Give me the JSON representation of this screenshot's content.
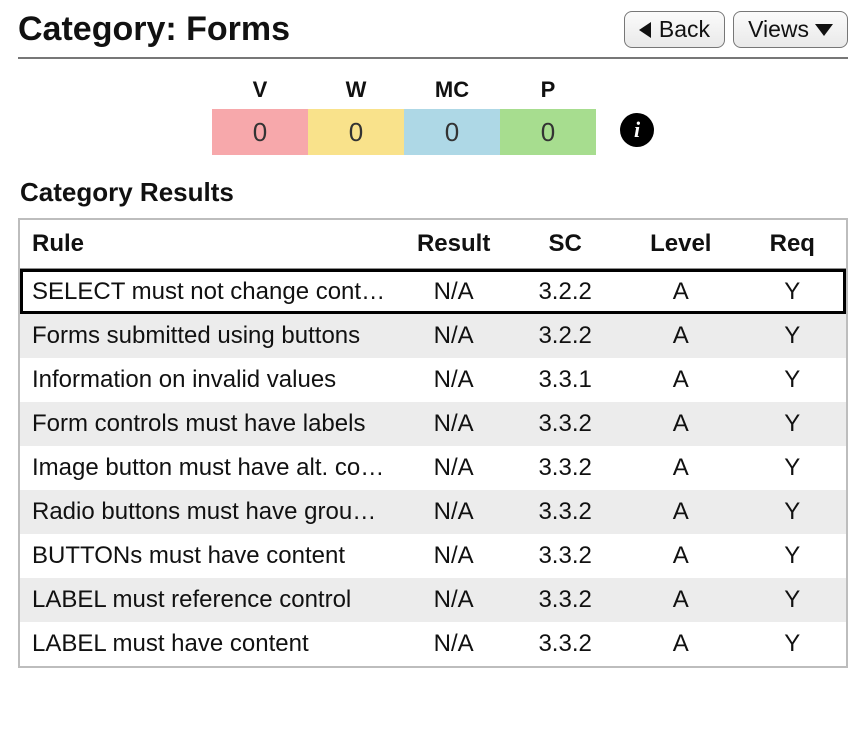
{
  "header": {
    "title": "Category: Forms",
    "back_label": "Back",
    "views_label": "Views"
  },
  "summary": {
    "tiles": [
      {
        "key": "V",
        "label": "V",
        "value": 0,
        "class": "t-v"
      },
      {
        "key": "W",
        "label": "W",
        "value": 0,
        "class": "t-w"
      },
      {
        "key": "MC",
        "label": "MC",
        "value": 0,
        "class": "t-mc"
      },
      {
        "key": "P",
        "label": "P",
        "value": 0,
        "class": "t-p"
      }
    ]
  },
  "results": {
    "title": "Category Results",
    "columns": {
      "rule": "Rule",
      "result": "Result",
      "sc": "SC",
      "level": "Level",
      "req": "Req"
    },
    "rows": [
      {
        "rule": "SELECT must not change context",
        "result": "N/A",
        "sc": "3.2.2",
        "level": "A",
        "req": "Y",
        "selected": true
      },
      {
        "rule": "Forms submitted using buttons",
        "result": "N/A",
        "sc": "3.2.2",
        "level": "A",
        "req": "Y",
        "selected": false
      },
      {
        "rule": "Information on invalid values",
        "result": "N/A",
        "sc": "3.3.1",
        "level": "A",
        "req": "Y",
        "selected": false
      },
      {
        "rule": "Form controls must have labels",
        "result": "N/A",
        "sc": "3.3.2",
        "level": "A",
        "req": "Y",
        "selected": false
      },
      {
        "rule": "Image button must have alt. content",
        "result": "N/A",
        "sc": "3.3.2",
        "level": "A",
        "req": "Y",
        "selected": false
      },
      {
        "rule": "Radio buttons must have grouping label",
        "result": "N/A",
        "sc": "3.3.2",
        "level": "A",
        "req": "Y",
        "selected": false
      },
      {
        "rule": "BUTTONs must have content",
        "result": "N/A",
        "sc": "3.3.2",
        "level": "A",
        "req": "Y",
        "selected": false
      },
      {
        "rule": "LABEL must reference control",
        "result": "N/A",
        "sc": "3.3.2",
        "level": "A",
        "req": "Y",
        "selected": false
      },
      {
        "rule": "LABEL must have content",
        "result": "N/A",
        "sc": "3.3.2",
        "level": "A",
        "req": "Y",
        "selected": false
      }
    ]
  }
}
